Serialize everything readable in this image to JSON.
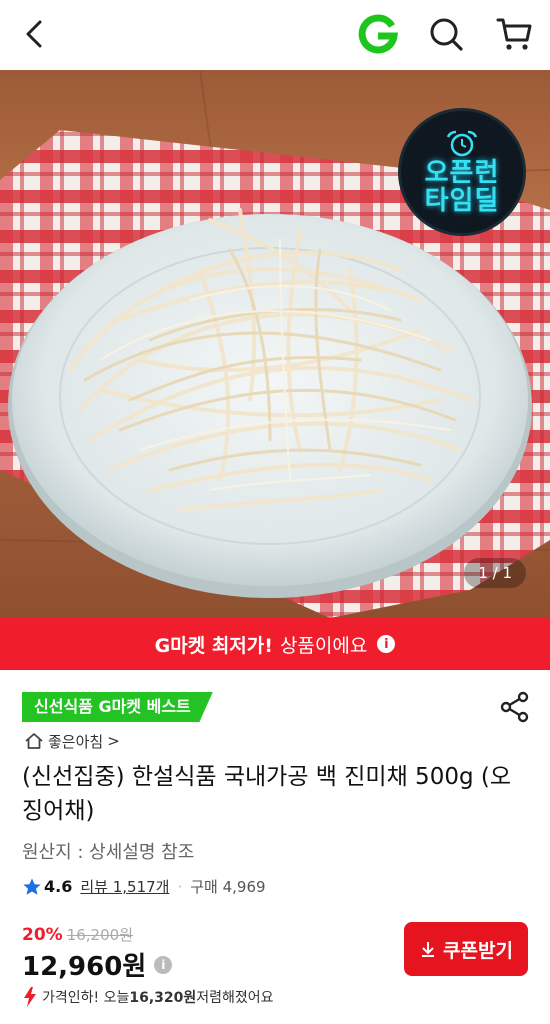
{
  "header": {
    "back_icon": "chevron-left-icon",
    "gmarket_icon": "gmarket-logo-icon",
    "search_icon": "search-icon",
    "cart_icon": "cart-icon"
  },
  "hero": {
    "badge_text_line1": "오픈런",
    "badge_text_line2": "타임딜",
    "pager": "1 / 1"
  },
  "promo": {
    "bold_text": "G마켓 최저가!",
    "text": "상품이에요",
    "info_symbol": "i",
    "color": "#f01d2c"
  },
  "product": {
    "best_tag": "신선식품 G마켓 베스트",
    "best_tag_color": "#22c322",
    "store_name": "좋은아침",
    "store_chevron": ">",
    "title": "(신선집중) 한설식품 국내가공 백 진미채 500g (오징어채)",
    "origin": "원산지 : 상세설명 참조",
    "rating": "4.6",
    "review": "리뷰 1,517개",
    "separator": "·",
    "purchases": "구매 4,969",
    "discount": "20%",
    "original_price": "16,200원",
    "price": "12,960원",
    "price_info": "i",
    "price_down_prefix": "가격인하! 오늘 ",
    "price_down_amount": "16,320원",
    "price_down_suffix": " 저렴해졌어요",
    "coupon_button": "쿠폰받기",
    "coupon_color": "#e5141f"
  }
}
